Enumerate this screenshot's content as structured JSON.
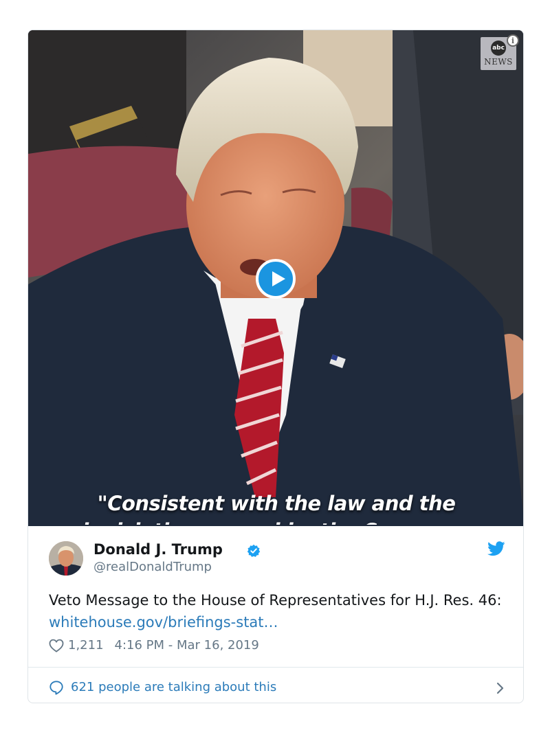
{
  "video": {
    "network_logo_text": "abc",
    "network_text": "NEWS",
    "info_glyph": "i",
    "caption_line1": "\"Consistent with the law and the",
    "caption_line2": "legislation passed by the Congress,",
    "play_icon": "play-icon"
  },
  "tweet": {
    "display_name": "Donald J. Trump",
    "handle": "@realDonaldTrump",
    "body_text": "Veto Message to the House of Representatives for H.J. Res. 46: ",
    "link_text": "whitehouse.gov/briefings-stat…",
    "likes": "1,211",
    "timestamp": "4:16 PM - Mar 16, 2019",
    "talking_text": "621 people are talking about this"
  },
  "colors": {
    "link": "#2b7bb9",
    "verified": "#1da1f2",
    "twitter_blue": "#1da1f2",
    "play_button": "#1b95e0"
  }
}
